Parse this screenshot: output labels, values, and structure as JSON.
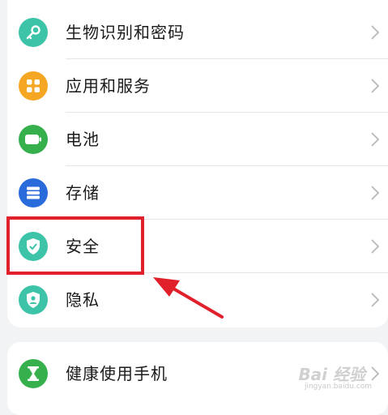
{
  "settings_group_1": {
    "items": [
      {
        "label": "生物识别和密码",
        "icon": "key-icon",
        "color": "#3cc3a8"
      },
      {
        "label": "应用和服务",
        "icon": "apps-grid-icon",
        "color": "#f5a623"
      },
      {
        "label": "电池",
        "icon": "battery-icon",
        "color": "#35b04c"
      },
      {
        "label": "存储",
        "icon": "storage-icon",
        "color": "#2a6bdc"
      },
      {
        "label": "安全",
        "icon": "shield-check-icon",
        "color": "#3cc3a8"
      },
      {
        "label": "隐私",
        "icon": "privacy-icon",
        "color": "#3cc3a8"
      }
    ]
  },
  "settings_group_2": {
    "items": [
      {
        "label": "健康使用手机",
        "icon": "hourglass-icon",
        "color": "#35b04c"
      }
    ]
  },
  "annotation": {
    "highlight_color": "#e0202a"
  },
  "watermark": {
    "text": "Bai 经验",
    "sub": "jingyan.baidu.com"
  }
}
